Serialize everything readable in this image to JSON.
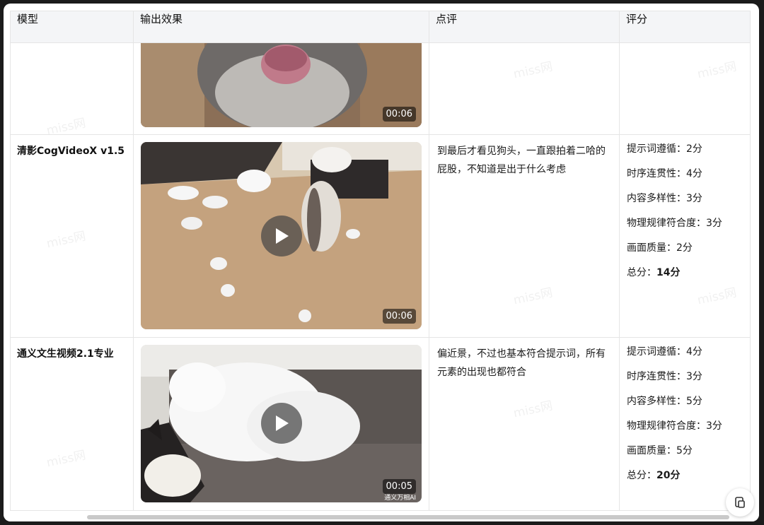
{
  "table": {
    "headers": [
      "模型",
      "输出效果",
      "点评",
      "评分"
    ]
  },
  "rows": [
    {
      "model": "",
      "video": {
        "timestamp": "00:06"
      },
      "review": "",
      "scores": []
    },
    {
      "model": "清影CogVideoX v1.5",
      "video": {
        "timestamp": "00:06"
      },
      "review": "到最后才看见狗头，一直跟拍着二哈的屁股，不知道是出于什么考虑",
      "scores": [
        {
          "label": "提示词遵循：",
          "value": "2分"
        },
        {
          "label": "时序连贯性：",
          "value": "4分"
        },
        {
          "label": "内容多样性：",
          "value": "3分"
        },
        {
          "label": "物理规律符合度：",
          "value": "3分"
        },
        {
          "label": "画面质量：",
          "value": "2分"
        }
      ],
      "total": {
        "label": "总分：",
        "value": "14分"
      }
    },
    {
      "model": "通义文生视频2.1专业",
      "video": {
        "timestamp": "00:05",
        "source_mark": "通义万相AI"
      },
      "review": "偏近景，不过也基本符合提示词，所有元素的出现也都符合",
      "scores": [
        {
          "label": "提示词遵循：",
          "value": "4分"
        },
        {
          "label": "时序连贯性：",
          "value": "3分"
        },
        {
          "label": "内容多样性：",
          "value": "5分"
        },
        {
          "label": "物理规律符合度：",
          "value": "3分"
        },
        {
          "label": "画面质量：",
          "value": "5分"
        }
      ],
      "total": {
        "label": "总分：",
        "value": "20分"
      }
    }
  ],
  "watermark": "miss网",
  "icons": {
    "play": "play-icon",
    "copy": "copy-icon"
  },
  "colors": {
    "header_bg": "#f4f5f7",
    "border": "#e5e5e5",
    "timestamp_bg": "#000000"
  }
}
